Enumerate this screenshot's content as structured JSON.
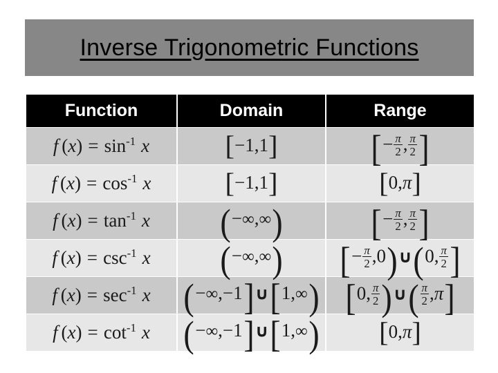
{
  "slide": {
    "title": "Inverse Trigonometric Functions",
    "background_color": "#ffffff",
    "banner_color": "#878787",
    "header_color": "#000000",
    "header_text_color": "#ffffff",
    "row_dark_color": "#c9c9c9",
    "row_light_color": "#e7e7e7"
  },
  "table": {
    "headers": {
      "function": "Function",
      "domain": "Domain",
      "range": "Range"
    },
    "rows": [
      {
        "function": "f (x) = sin-1 x",
        "function_name": "sin",
        "domain": "[-1, 1]",
        "range": "[-p/2, p/2]"
      },
      {
        "function": "f (x) = cos-1 x",
        "function_name": "cos",
        "domain": "[-1, 1]",
        "range": "[0, p]"
      },
      {
        "function": "f (x) = tan-1 x",
        "function_name": "tan",
        "domain": "(-8, 8)",
        "range": "[-p/2, p/2]"
      },
      {
        "function": "f (x) = csc-1 x",
        "function_name": "csc",
        "domain": "(-8, 8)",
        "range": "[-p/2, 0) U (0, p/2]"
      },
      {
        "function": "f (x) = sec-1 x",
        "function_name": "sec",
        "domain": "(-8, -1] U [1, 8)",
        "range": "[0, p/2) U (p/2, p]"
      },
      {
        "function": "f (x) = cot-1 x",
        "function_name": "cot",
        "domain": "(-8, -1] U [1, 8)",
        "range": "[0, p]"
      }
    ]
  }
}
